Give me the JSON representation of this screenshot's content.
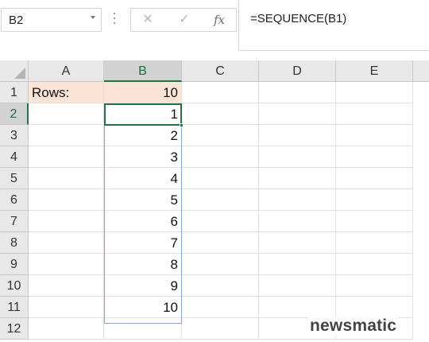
{
  "formula_bar": {
    "name_box": "B2",
    "cancel_icon": "close-icon",
    "enter_icon": "check-icon",
    "fx_label": "fx",
    "formula": "=SEQUENCE(B1)"
  },
  "columns": [
    "A",
    "B",
    "C",
    "D",
    "E"
  ],
  "selected_column": "B",
  "rows": [
    "1",
    "2",
    "3",
    "4",
    "5",
    "6",
    "7",
    "8",
    "9",
    "10",
    "11",
    "12"
  ],
  "selected_row": "2",
  "cells": {
    "A1": "Rows:",
    "B1": "10",
    "B2": "1",
    "B3": "2",
    "B4": "3",
    "B5": "4",
    "B6": "5",
    "B7": "6",
    "B8": "7",
    "B9": "8",
    "B10": "9",
    "B11": "10"
  },
  "colors": {
    "accent": "#217346",
    "label_fill": "#fbe3d6",
    "spill_border": "#8aa4d3"
  },
  "watermark": "newsmatic"
}
